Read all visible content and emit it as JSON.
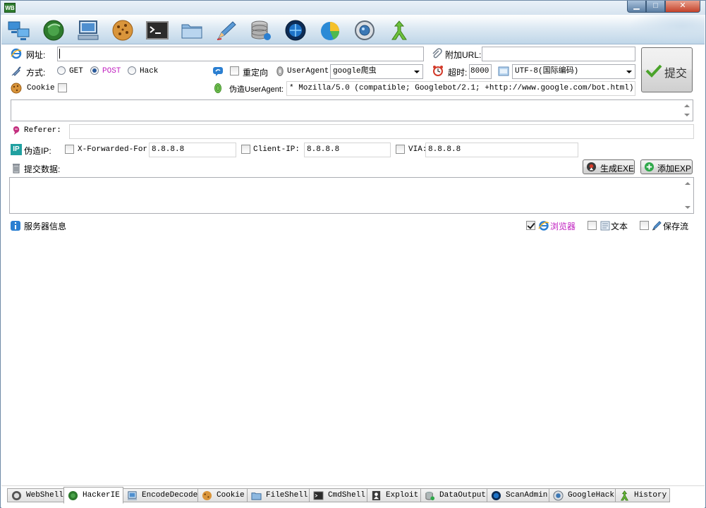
{
  "window": {
    "app_icon_text": "WB",
    "controls": {
      "minimize": "▁",
      "maximize": "□",
      "close": "✕"
    }
  },
  "toolbar": {
    "icons": [
      "network-icon",
      "browser-icon",
      "computer-icon",
      "cookie-icon",
      "terminal-icon",
      "folder-icon",
      "pen-icon",
      "database-icon",
      "globe-icon",
      "pie-chart-icon",
      "scan-icon",
      "history-icon"
    ]
  },
  "form": {
    "url_label": "网址:",
    "url_value": "",
    "extra_url_label": "附加URL:",
    "extra_url_value": "",
    "submit_label": "提交",
    "method_label": "方式:",
    "methods": [
      "GET",
      "POST",
      "Hack"
    ],
    "selected_method": "POST",
    "redirect_label": "重定向",
    "useragent_label": "UserAgent:",
    "useragent_value": "google爬虫",
    "timeout_label": "超时:",
    "timeout_value": "8000",
    "encoding_value": "UTF-8(国际编码)",
    "cookie_label": "Cookie",
    "fake_ua_label": "伪造UserAgent:",
    "fake_ua_value": "* Mozilla/5.0 (compatible; Googlebot/2.1; +http://www.google.com/bot.html)",
    "referer_label": "Referer:",
    "referer_value": "",
    "fake_ip_label": "伪造IP:",
    "xff_label": "X-Forwarded-For:",
    "xff_value": "8.8.8.8",
    "client_ip_label": "Client-IP:",
    "client_ip_value": "8.8.8.8",
    "via_label": "VIA:",
    "via_value": "8.8.8.8",
    "post_data_label": "提交数据:",
    "gen_exe_label": "生成EXE",
    "add_exp_label": "添加EXP"
  },
  "server": {
    "info_label": "服务器信息",
    "browser_label": "浏览器",
    "browser_checked": true,
    "text_label": "文本",
    "save_label": "保存流"
  },
  "tabs": [
    "WebShell",
    "HackerIE",
    "EncodeDecode",
    "Cookie",
    "FileShell",
    "CmdShell",
    "Exploit",
    "DataOutput",
    "ScanAdmin",
    "GoogleHack",
    "History"
  ],
  "active_tab": "HackerIE",
  "colors": {
    "accent_purple": "#c020c0",
    "titlebar": "#dfe9f3"
  }
}
